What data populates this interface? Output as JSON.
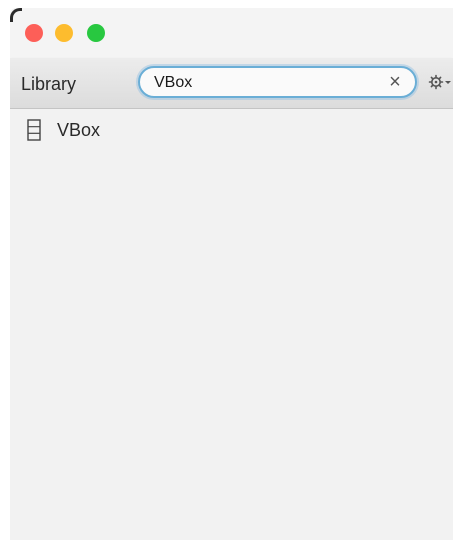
{
  "toolbar": {
    "library_label": "Library",
    "gear_icon": "gear-icon"
  },
  "search": {
    "value": "VBox",
    "clear_icon": "close-icon",
    "clear_glyph": "×"
  },
  "results": {
    "items": [
      {
        "label": "VBox",
        "icon": "vbox-layout-icon"
      }
    ]
  },
  "colors": {
    "close": "#fd5f58",
    "minimize": "#fdbc2e",
    "maximize": "#28c840",
    "search_focus": "#6aaed6"
  }
}
